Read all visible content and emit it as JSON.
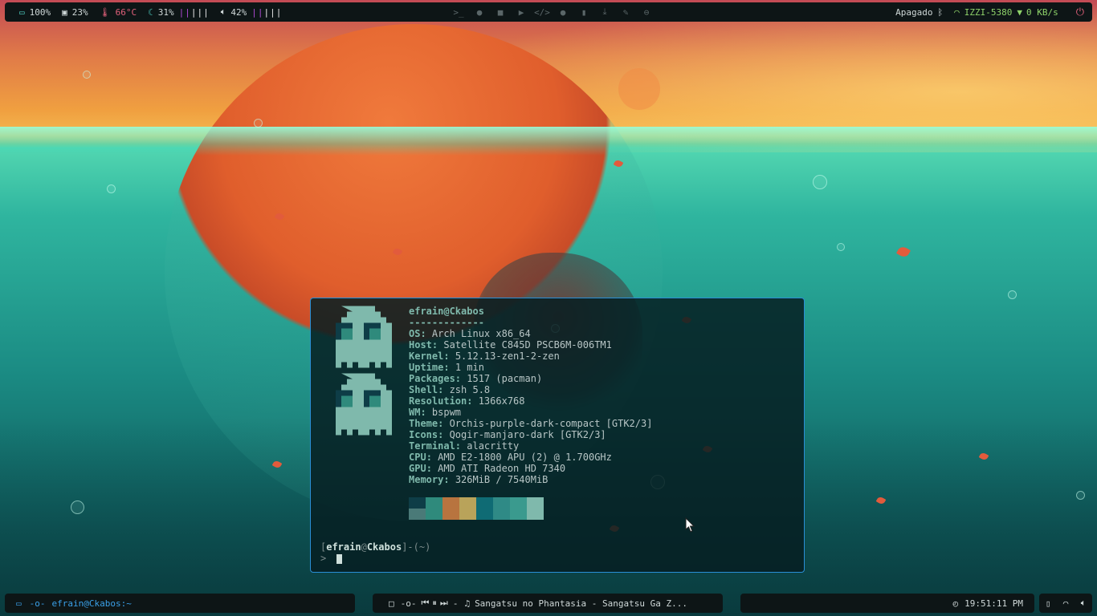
{
  "topbar": {
    "battery": {
      "icon": "battery-icon",
      "value": "100%"
    },
    "cpu": {
      "icon": "cpu-icon",
      "value": "23%"
    },
    "temp": {
      "icon": "thermometer-icon",
      "value": "66°C",
      "color": "#e0607a"
    },
    "memory": {
      "icon": "moon-icon",
      "value": "31%",
      "bars": "||",
      "bars_white": "|||"
    },
    "volume": {
      "icon": "speaker-icon",
      "value": "42%",
      "bars": "||",
      "bars_white": "|||"
    },
    "center_icons": [
      "terminal-icon",
      "firefox-icon",
      "folder-icon",
      "play-icon",
      "code-icon",
      "chat-icon",
      "file-icon",
      "download-icon",
      "wrench-icon",
      "gamepad-icon"
    ],
    "bluetooth_status": "Apagado",
    "wifi_name": "IZZI-5380",
    "net_speed": "0 KB/s"
  },
  "terminal": {
    "header": "efrain@Ckabos",
    "separator": "-------------",
    "rows": [
      {
        "k": "OS",
        "v": "Arch Linux x86_64"
      },
      {
        "k": "Host",
        "v": "Satellite C845D PSCB6M-006TM1"
      },
      {
        "k": "Kernel",
        "v": "5.12.13-zen1-2-zen"
      },
      {
        "k": "Uptime",
        "v": "1 min"
      },
      {
        "k": "Packages",
        "v": "1517 (pacman)"
      },
      {
        "k": "Shell",
        "v": "zsh 5.8"
      },
      {
        "k": "Resolution",
        "v": "1366x768"
      },
      {
        "k": "WM",
        "v": "bspwm"
      },
      {
        "k": "Theme",
        "v": "Orchis-purple-dark-compact [GTK2/3]"
      },
      {
        "k": "Icons",
        "v": "Qogir-manjaro-dark [GTK2/3]"
      },
      {
        "k": "Terminal",
        "v": "alacritty"
      },
      {
        "k": "CPU",
        "v": "AMD E2-1800 APU (2) @ 1.700GHz"
      },
      {
        "k": "GPU",
        "v": "AMD ATI Radeon HD 7340"
      },
      {
        "k": "Memory",
        "v": "326MiB / 7540MiB"
      }
    ],
    "swatches_top": [
      "#0e3d47",
      "#2f8a7c",
      "#b8743f",
      "#b9a35a",
      "#0f6b74",
      "#2f8a86",
      "#3a9a8e",
      "#7fb9ac"
    ],
    "swatches_bottom": [
      "#4a7a78",
      "#2f8a7c",
      "#b8743f",
      "#b9a35a",
      "#0f6b74",
      "#2f8a86",
      "#3a9a8e",
      "#7fb9ac"
    ],
    "prompt_user": "efrain",
    "prompt_at": "@",
    "prompt_host": "Ckabos",
    "prompt_dir": "(~)",
    "prompt_arrow": "> "
  },
  "bottombar": {
    "workspace_title": "efrain@Ckabos:~",
    "song": "Sangatsu no Phantasia - Sangatsu Ga Z...",
    "clock": "19:51:11 PM"
  },
  "colors": {
    "accent": "#2a8fd6",
    "bar_bg": "#0d1516",
    "violet": "#b04ad6",
    "green": "#8fd36a"
  }
}
